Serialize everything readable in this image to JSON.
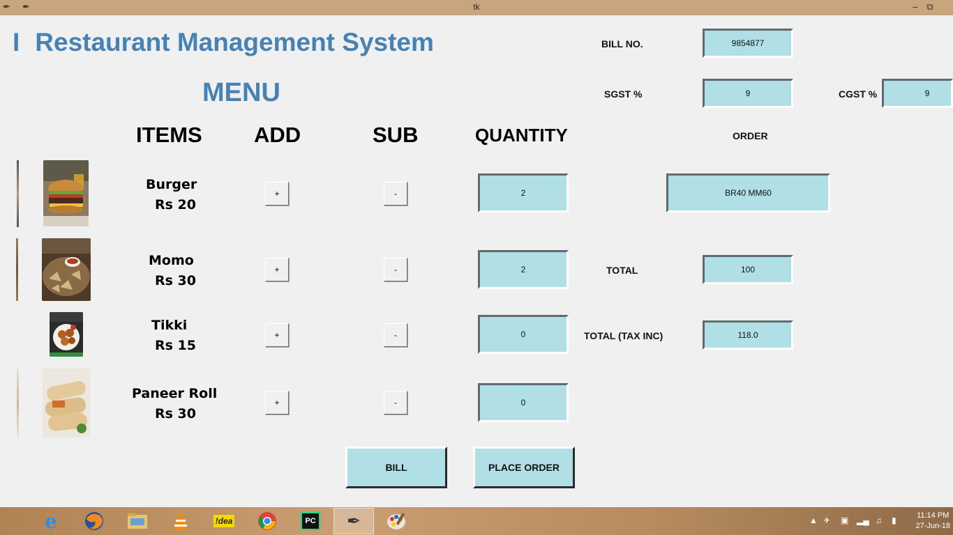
{
  "window": {
    "title": "tk"
  },
  "app": {
    "title": "Restaurant Management System",
    "title_prefix": "I",
    "menu_title": "MENU",
    "columns": {
      "items": "ITEMS",
      "add": "ADD",
      "sub": "SUB",
      "quantity": "QUANTITY"
    },
    "bill_no": {
      "label": "BILL NO.",
      "value": "9854877"
    },
    "sgst": {
      "label": "SGST %",
      "value": "9"
    },
    "cgst": {
      "label": "CGST %",
      "value": "9"
    },
    "order": {
      "label": "ORDER",
      "value": "BR40 MM60"
    },
    "total": {
      "label": "TOTAL",
      "value": "100"
    },
    "total_tax": {
      "label": "TOTAL (TAX INC)",
      "value": "118.0"
    },
    "items": [
      {
        "name": "Burger",
        "price": "Rs 20",
        "quantity": "2",
        "add": "+",
        "sub": "-"
      },
      {
        "name": "Momo",
        "price": "Rs 30",
        "quantity": "2",
        "add": "+",
        "sub": "-"
      },
      {
        "name": "Tikki",
        "price": "Rs 15",
        "quantity": "0",
        "add": "+",
        "sub": "-"
      },
      {
        "name": "Paneer Roll",
        "price": "Rs 30",
        "quantity": "0",
        "add": "+",
        "sub": "-"
      }
    ],
    "buttons": {
      "bill": "BILL",
      "place_order": "PLACE ORDER"
    },
    "colors": {
      "title": "#4682b4",
      "field_bg": "#b0e0e6",
      "window_bg": "#f0f0f0"
    }
  },
  "taskbar": {
    "apps": [
      {
        "name": "internet-explorer-icon",
        "glyph": "e"
      },
      {
        "name": "firefox-icon"
      },
      {
        "name": "file-explorer-icon"
      },
      {
        "name": "vlc-icon"
      },
      {
        "name": "idea-icon",
        "glyph": "!dea"
      },
      {
        "name": "chrome-icon"
      },
      {
        "name": "pycharm-icon",
        "glyph": "PC"
      },
      {
        "name": "tk-feather-icon"
      },
      {
        "name": "paint-icon"
      }
    ],
    "time": "11:14 PM",
    "date": "27-Jun-18"
  }
}
